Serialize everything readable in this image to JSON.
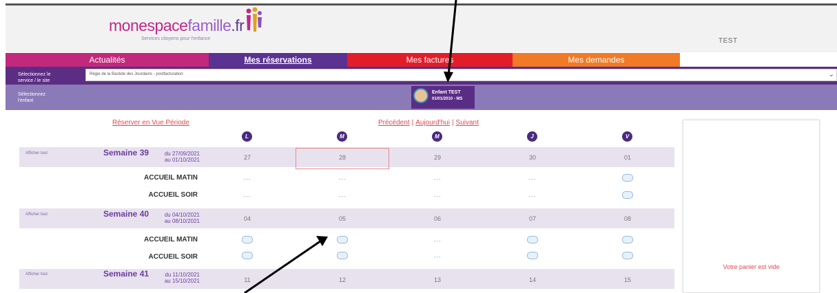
{
  "header": {
    "logo_part1": "monespace",
    "logo_part2": "famille",
    "logo_part3": ".fr",
    "tagline": "Services citoyens pour l'enfance",
    "user": "TEST"
  },
  "tabs": [
    {
      "label": "Actualités"
    },
    {
      "label": "Mes réservations"
    },
    {
      "label": "Mes factures"
    },
    {
      "label": "Mes demandes"
    }
  ],
  "selector": {
    "label_line1": "Sélectionnez le",
    "label_line2": "service / le site",
    "value": "Régie de la Bastide des Jourdains - postfacturation"
  },
  "child": {
    "label_line1": "Sélectionnez",
    "label_line2": "l'enfant",
    "name": "Enfant TEST",
    "dob": "01/01/2010 - MS"
  },
  "nav": {
    "period_view": "Réserver en Vue Période",
    "previous": "Précédent",
    "today": "Aujourd'hui",
    "next": "Suivant",
    "separator": "|"
  },
  "days": [
    "L",
    "M",
    "M",
    "J",
    "V"
  ],
  "show_all": "Afficher tout",
  "weeks": [
    {
      "title": "Semaine 39",
      "from": "du 27/09/2021",
      "to": "au 01/10/2021",
      "dates": [
        "27",
        "28",
        "29",
        "30",
        "01"
      ]
    },
    {
      "title": "Semaine 40",
      "from": "du 04/10/2021",
      "to": "au 08/10/2021",
      "dates": [
        "04",
        "05",
        "06",
        "07",
        "08"
      ]
    },
    {
      "title": "Semaine 41",
      "from": "du 11/10/2021",
      "to": "au 15/10/2021",
      "dates": [
        "11",
        "12",
        "13",
        "14",
        "15"
      ]
    }
  ],
  "services": {
    "morning": "ACCUEIL MATIN",
    "evening": "ACCUEIL SOIR",
    "dash": "---"
  },
  "cart": {
    "empty": "Votre panier est vide"
  },
  "colors": {
    "news": "#c2287c",
    "reservations": "#5a3292",
    "invoices": "#e21d2a",
    "requests": "#f07a26"
  }
}
